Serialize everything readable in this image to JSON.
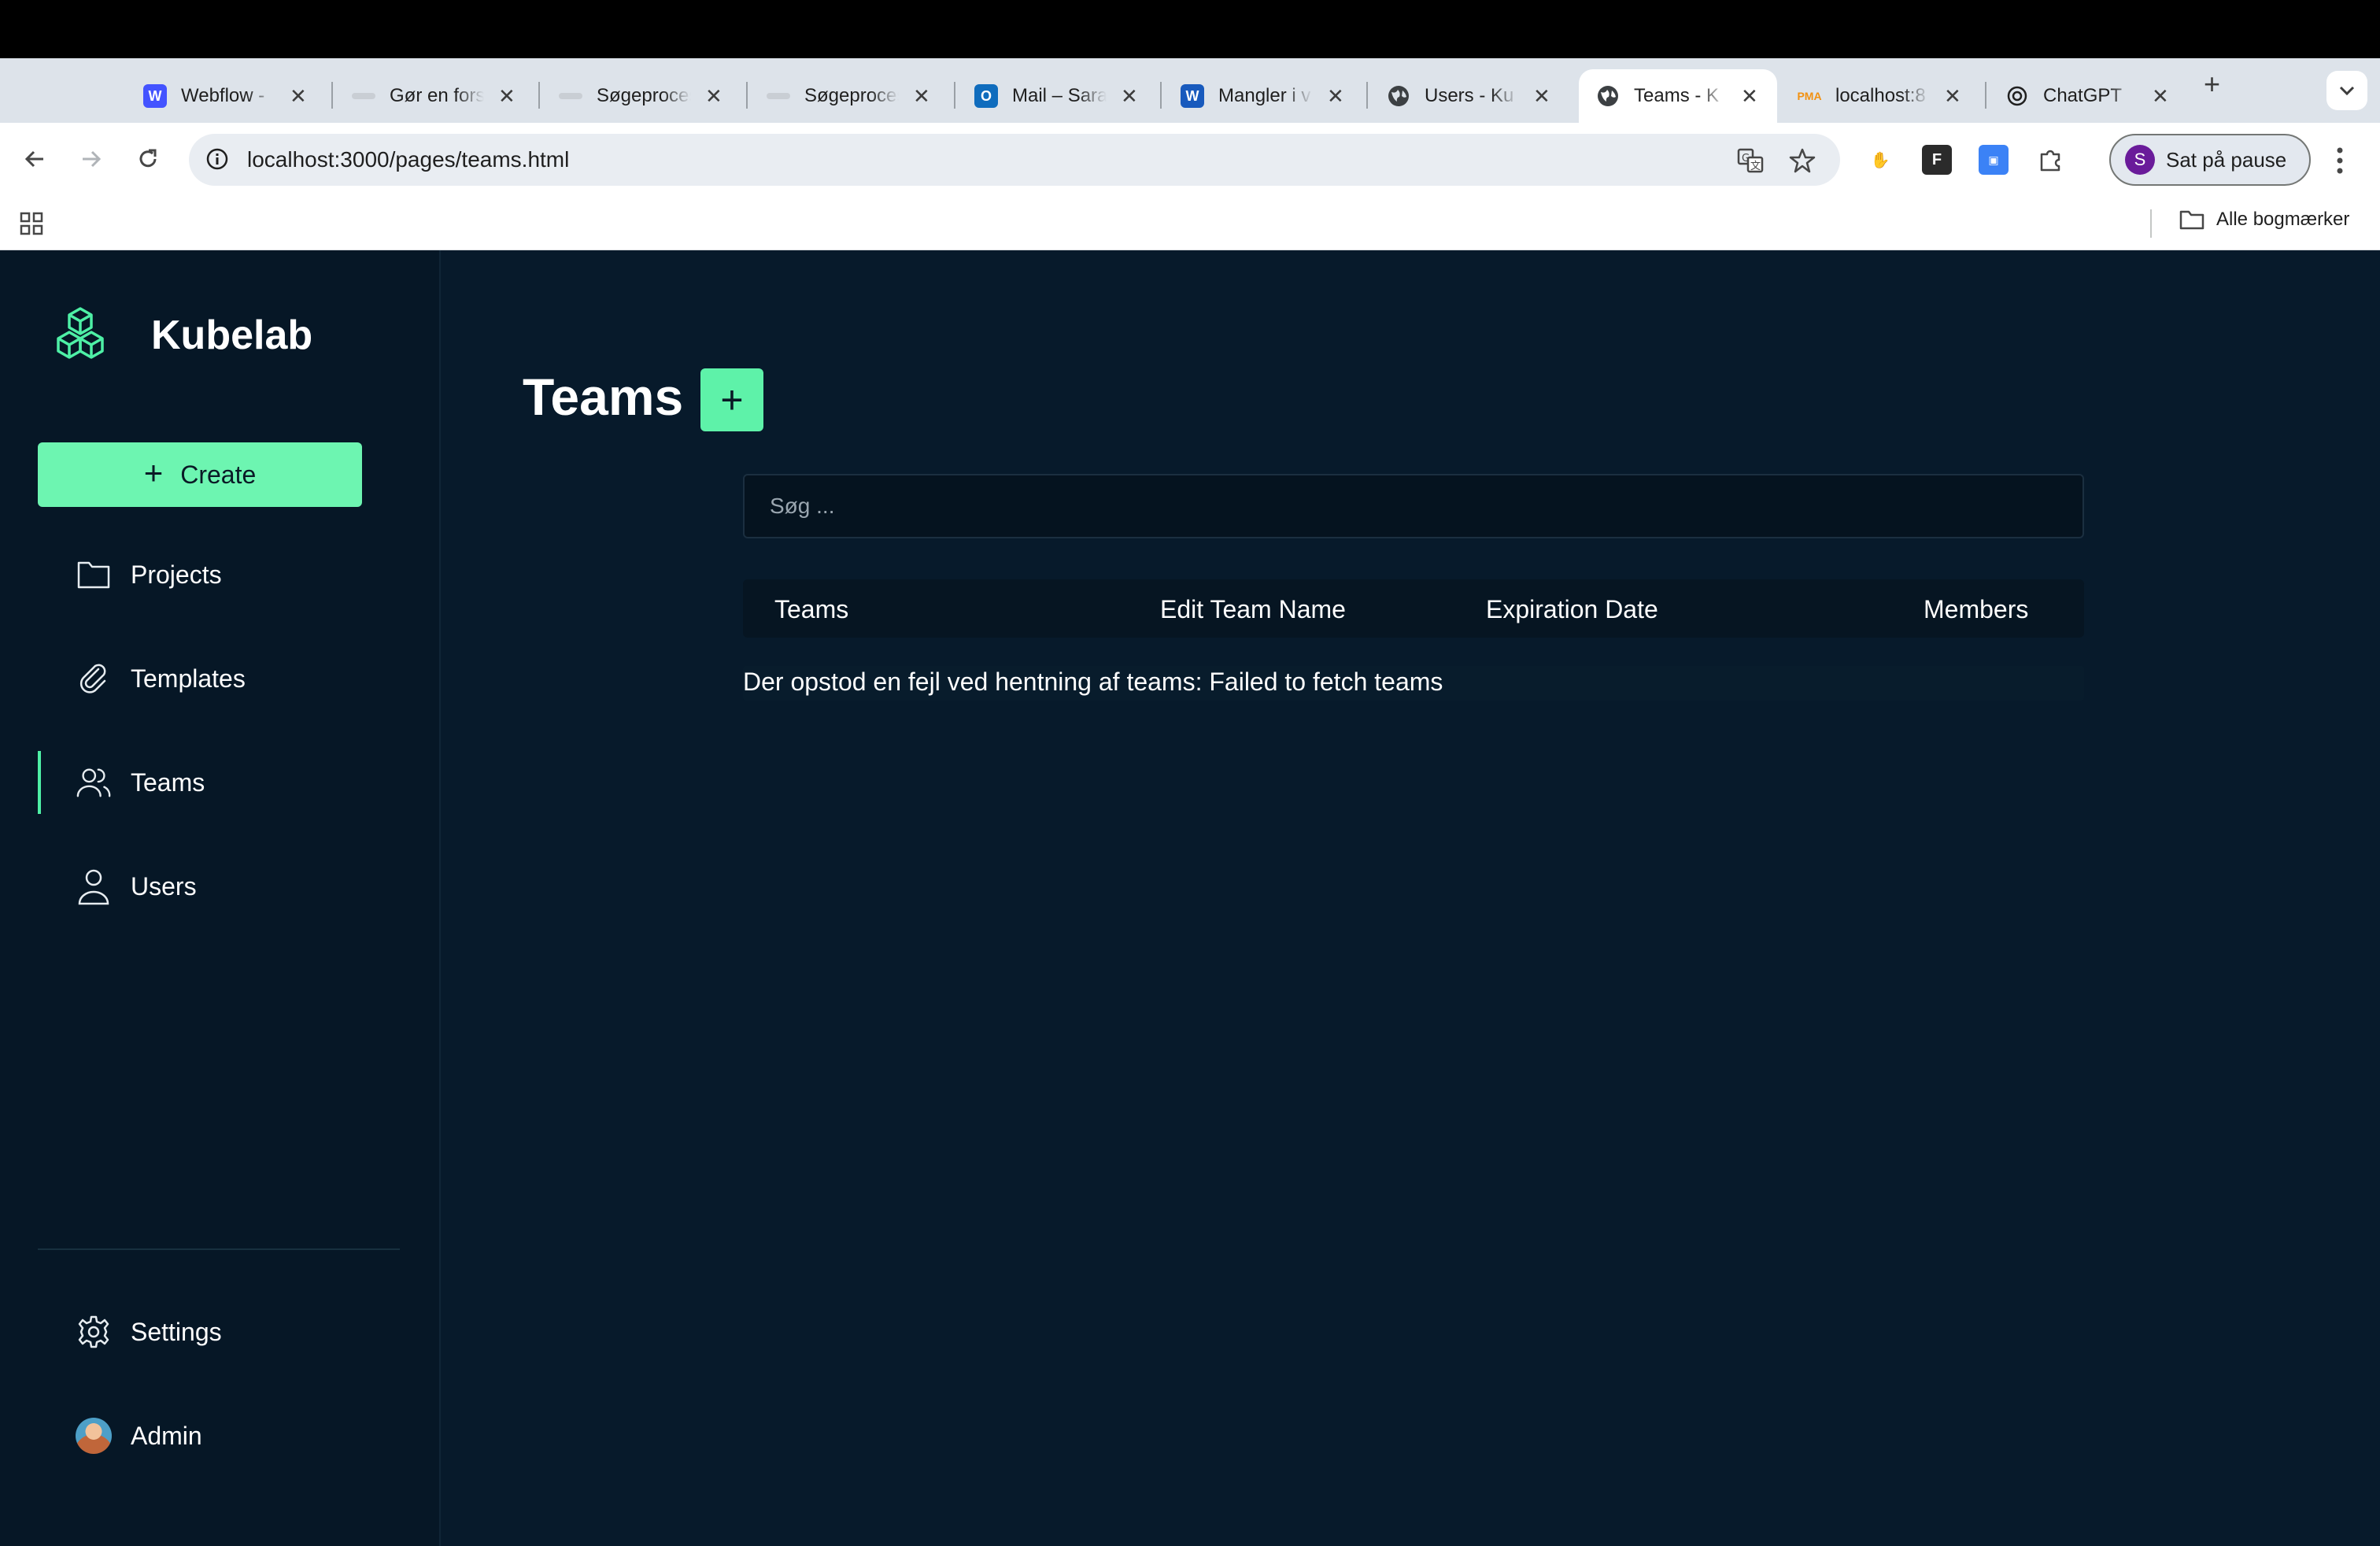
{
  "browser": {
    "tabs": [
      {
        "title": "Webflow - ",
        "favicon": "webflow-icon",
        "color": "#4353ff"
      },
      {
        "title": "Gør en forskel",
        "favicon": "page-icon",
        "color": "#c9ced4"
      },
      {
        "title": "Søgeprocessen",
        "favicon": "page-icon",
        "color": "#c9ced4"
      },
      {
        "title": "Søgeprocessen",
        "favicon": "page-icon",
        "color": "#c9ced4"
      },
      {
        "title": "Mail – Sara",
        "favicon": "outlook-icon",
        "color": "#0f6cbd"
      },
      {
        "title": "Mangler i v",
        "favicon": "word-icon",
        "color": "#185abd"
      },
      {
        "title": "Users - Ku",
        "favicon": "globe-icon",
        "color": "#3c4043"
      },
      {
        "title": "Teams - K",
        "favicon": "globe-icon",
        "color": "#3c4043"
      },
      {
        "title": "localhost:8",
        "favicon": "phpmyadmin-icon",
        "color": "#f29111"
      },
      {
        "title": "ChatGPT",
        "favicon": "chatgpt-icon",
        "color": "#1f1f1f"
      }
    ],
    "active_tab": 7,
    "url_host": "localhost",
    "url_rest": ":3000/pages/teams.html",
    "profile_initial": "S",
    "profile_label": "Sat på pause",
    "bookmarks_all": "Alle bogmærker"
  },
  "app": {
    "brand": "Kubelab",
    "accent": "#6df5b1",
    "create_label": "Create",
    "nav": {
      "projects": "Projects",
      "templates": "Templates",
      "teams": "Teams",
      "users": "Users",
      "settings": "Settings",
      "admin": "Admin"
    },
    "page_title": "Teams",
    "search_placeholder": "Søg ...",
    "table": {
      "headers": [
        "Teams",
        "Edit Team Name",
        "Expiration Date",
        "Members"
      ]
    },
    "error_message": "Der opstod en fejl ved hentning af teams: Failed to fetch teams"
  }
}
